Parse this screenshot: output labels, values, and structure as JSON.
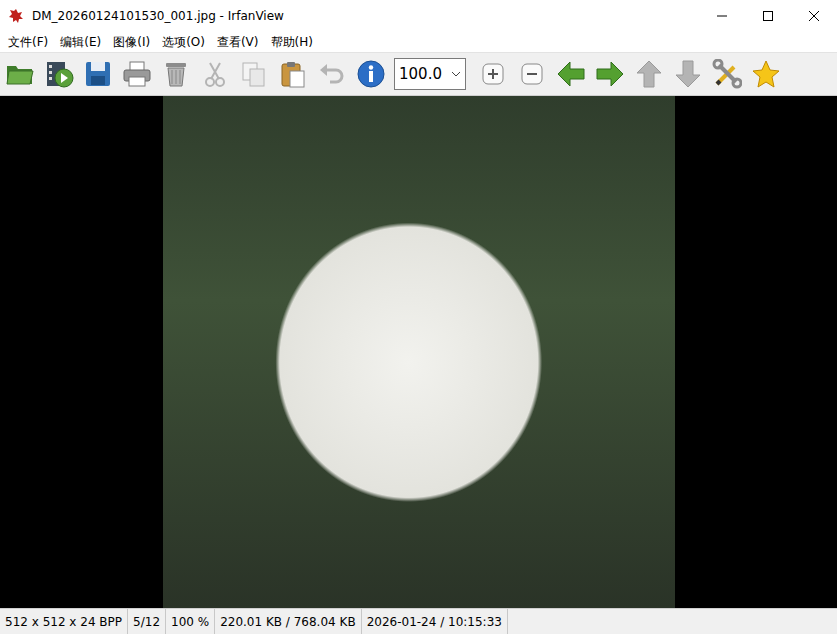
{
  "window": {
    "title": "DM_20260124101530_001.jpg - IrfanView"
  },
  "menu": [
    "文件(F)",
    "编辑(E)",
    "图像(I)",
    "选项(O)",
    "查看(V)",
    "帮助(H)"
  ],
  "toolbar": {
    "left": [
      {
        "kind": "open",
        "disabled": false
      },
      {
        "kind": "slideshow",
        "disabled": false
      },
      {
        "kind": "save",
        "disabled": false
      },
      {
        "kind": "print",
        "disabled": false
      },
      {
        "kind": "delete",
        "disabled": false
      },
      {
        "kind": "cut",
        "disabled": true
      },
      {
        "kind": "copy",
        "disabled": true
      },
      {
        "kind": "paste",
        "disabled": false
      },
      {
        "kind": "undo",
        "disabled": true
      },
      {
        "kind": "info",
        "disabled": false
      }
    ],
    "zoom": "100.0",
    "right": [
      {
        "kind": "zoomin",
        "disabled": false
      },
      {
        "kind": "zoomout",
        "disabled": false
      },
      {
        "kind": "prev",
        "disabled": false
      },
      {
        "kind": "next",
        "disabled": false
      },
      {
        "kind": "up",
        "disabled": true
      },
      {
        "kind": "down",
        "disabled": true
      },
      {
        "kind": "settings",
        "disabled": false
      },
      {
        "kind": "star",
        "disabled": false
      }
    ]
  },
  "status_bar": [
    "512 x 512 x 24 BPP",
    "5/12",
    "100 %",
    "220.01 KB / 768.04 KB",
    "2026-01-24 / 10:15:33"
  ]
}
